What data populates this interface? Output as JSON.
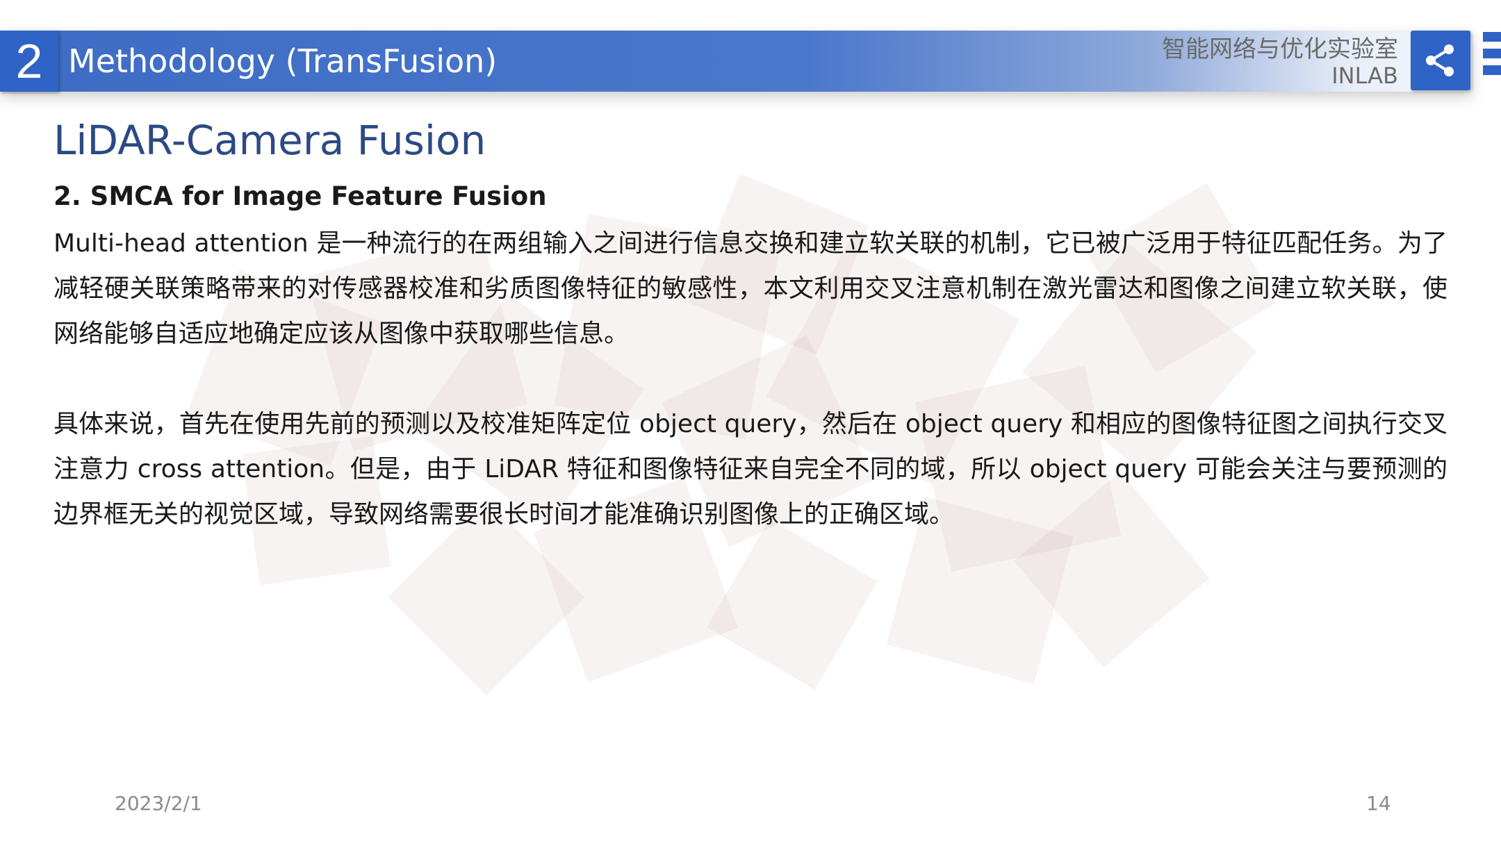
{
  "header": {
    "section_number": "2",
    "title": "Methodology (TransFusion)",
    "lab_name_cn": "智能网络与优化实验室",
    "lab_name_en": "INLAB"
  },
  "slide": {
    "heading": "LiDAR-Camera Fusion",
    "subheading": "2. SMCA for Image Feature Fusion",
    "paragraphs": [
      "Multi-head attention 是一种流行的在两组输入之间进行信息交换和建立软关联的机制，它已被广泛用于特征匹配任务。为了减轻硬关联策略带来的对传感器校准和劣质图像特征的敏感性，本文利用交叉注意机制在激光雷达和图像之间建立软关联，使网络能够自适应地确定应该从图像中获取哪些信息。",
      "具体来说，首先在使用先前的预测以及校准矩阵定位 object query，然后在 object query 和相应的图像特征图之间执行交叉注意力 cross attention。但是，由于 LiDAR 特征和图像特征来自完全不同的域，所以 object query 可能会关注与要预测的边界框无关的视觉区域，导致网络需要很长时间才能准确识别图像上的正确区域。"
    ]
  },
  "footer": {
    "date": "2023/2/1",
    "page_number": "14"
  },
  "icons": {
    "share": "share-icon",
    "menu": "menu-bars-icon"
  },
  "colors": {
    "accent_blue": "#2f63c5",
    "heading_blue": "#2b4a84",
    "watermark": "#f3e6e6"
  }
}
